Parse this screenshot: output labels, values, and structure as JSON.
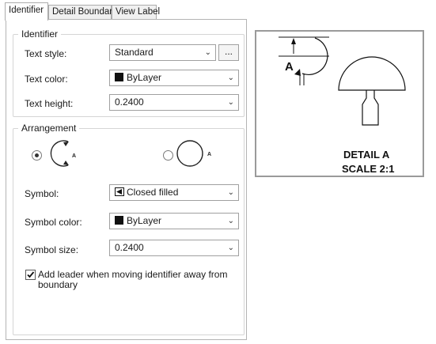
{
  "tabs": [
    {
      "label": "Identifier",
      "active": true
    },
    {
      "label": "Detail Boundary",
      "active": false
    },
    {
      "label": "View Label",
      "active": false
    }
  ],
  "identifier": {
    "title": "Identifier",
    "text_style_label": "Text style:",
    "text_style_value": "Standard",
    "ellipsis_label": "...",
    "text_color_label": "Text color:",
    "text_color_value": "ByLayer",
    "text_height_label": "Text height:",
    "text_height_value": "0.2400"
  },
  "arrangement": {
    "title": "Arrangement",
    "option_left_letter": "A",
    "option_right_letter": "A",
    "selected": "left",
    "symbol_label": "Symbol:",
    "symbol_value": "Closed filled",
    "symbol_color_label": "Symbol color:",
    "symbol_color_value": "ByLayer",
    "symbol_size_label": "Symbol size:",
    "symbol_size_value": "0.2400",
    "leader_checkbox_label_line1": "Add leader when moving identifier away from",
    "leader_checkbox_label_line2": "boundary",
    "leader_checked": true
  },
  "preview": {
    "identifier_letter": "A",
    "detail_title": "DETAIL A",
    "scale_text": "SCALE 2:1"
  },
  "colors": {
    "swatch": "#111111",
    "border": "#a0a0a0"
  }
}
